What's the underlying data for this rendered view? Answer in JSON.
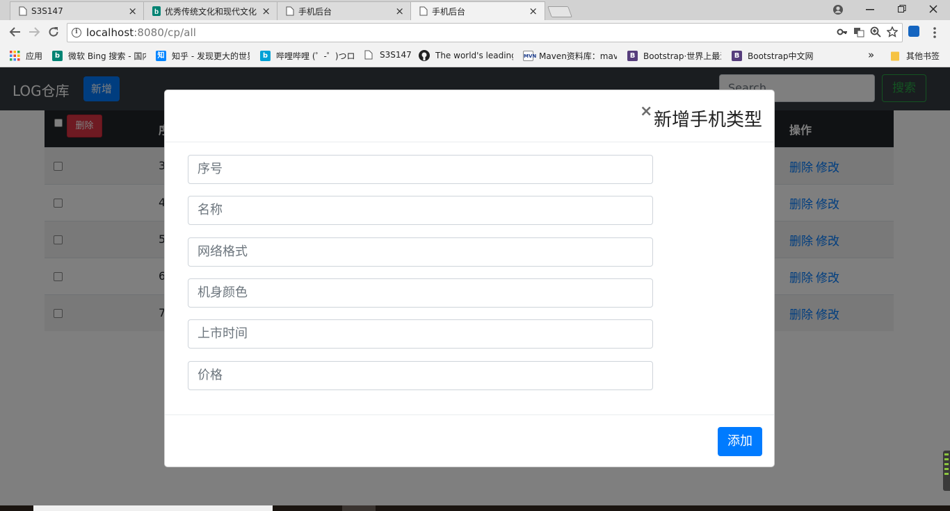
{
  "browser": {
    "tabs": [
      {
        "title": "S3S147",
        "icon": "page-icon"
      },
      {
        "title": "优秀传统文化和现代文化",
        "icon": "bing-icon"
      },
      {
        "title": "手机后台",
        "icon": "page-icon"
      },
      {
        "title": "手机后台",
        "icon": "page-icon",
        "active": true
      }
    ],
    "tab_close_glyph": "×",
    "url_host": "localhost",
    "url_rest": ":8080/cp/all",
    "bookmarks": [
      {
        "label": "应用",
        "icon": "apps-grid-icon",
        "color": "#e8453c"
      },
      {
        "label": "微软 Bing 搜索 - 国内",
        "icon": "bing-icon",
        "color": "#008373"
      },
      {
        "label": "知乎 - 发现更大的世界",
        "icon": "zhihu-icon",
        "color": "#0084ff"
      },
      {
        "label": "哔哩哔哩 (゜-゜)つロ",
        "icon": "bilibili-icon",
        "color": "#00a1d6"
      },
      {
        "label": "S3S147",
        "icon": "page-icon",
        "color": "#ffffff"
      },
      {
        "label": "The world's leading",
        "icon": "github-icon",
        "color": "#222222"
      },
      {
        "label": "Maven资料库：maven",
        "icon": "maven-icon",
        "color": "#ffffff"
      },
      {
        "label": "Bootstrap·世界上最流行",
        "icon": "bootstrap-icon",
        "color": "#563d7c"
      },
      {
        "label": "Bootstrap中文网",
        "icon": "bootstrap-icon",
        "color": "#563d7c"
      }
    ],
    "bookmarks_overflow": "»",
    "other_bookmarks": "其他书签"
  },
  "navbar": {
    "brand": "LOG仓库",
    "add_button": "新增",
    "search_placeholder": "Search",
    "search_button": "搜索"
  },
  "table": {
    "delete_all_button": "删除",
    "header_seq": "序",
    "header_actions": "操作",
    "rows": [
      {
        "seq": "3",
        "delete": "删除",
        "edit": "修改"
      },
      {
        "seq": "4",
        "delete": "删除",
        "edit": "修改"
      },
      {
        "seq": "5",
        "delete": "删除",
        "edit": "修改"
      },
      {
        "seq": "6",
        "delete": "删除",
        "edit": "修改"
      },
      {
        "seq": "7",
        "delete": "删除",
        "edit": "修改"
      }
    ]
  },
  "modal": {
    "title": "新增手机类型",
    "close_glyph": "×",
    "fields": [
      {
        "placeholder": "序号"
      },
      {
        "placeholder": "名称"
      },
      {
        "placeholder": "网络格式"
      },
      {
        "placeholder": "机身颜色"
      },
      {
        "placeholder": "上市时间"
      },
      {
        "placeholder": "价格"
      }
    ],
    "submit_button": "添加"
  },
  "colors": {
    "primary": "#007bff",
    "danger": "#dc3545",
    "success": "#28a745",
    "navbar_bg": "#343a40"
  }
}
